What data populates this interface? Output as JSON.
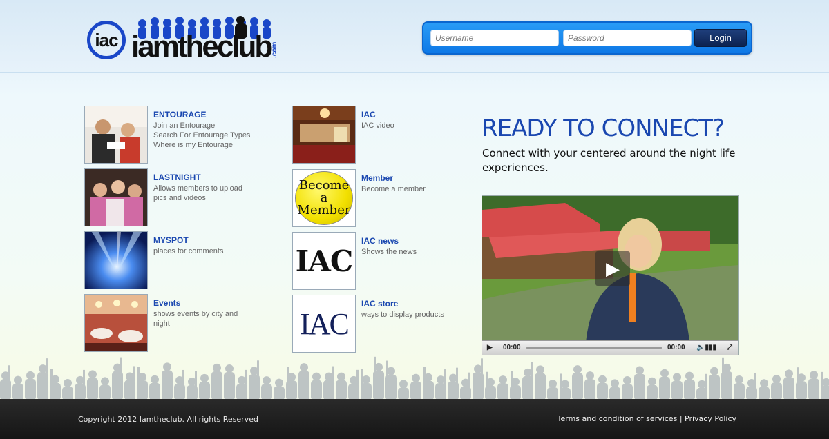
{
  "header": {
    "logo_short": "iac",
    "logo_word": "iamtheclub",
    "logo_com": ".com"
  },
  "login": {
    "username_placeholder": "Username",
    "password_placeholder": "Password",
    "button_label": "Login",
    "accent_color": "#1180e8"
  },
  "left_column": [
    {
      "title": "ENTOURAGE",
      "desc": [
        "Join an Entourage",
        "Search For Entourage Types",
        "Where is my Entourage"
      ],
      "thumb_icon": "people-dining-photo"
    },
    {
      "title": "LASTNIGHT",
      "desc": [
        "Allows members to upload",
        "pics and videos"
      ],
      "thumb_icon": "party-photo"
    },
    {
      "title": "MYSPOT",
      "desc": [
        "places for comments"
      ],
      "thumb_icon": "stage-lights-photo"
    },
    {
      "title": "Events",
      "desc": [
        "shows events by city and",
        "night"
      ],
      "thumb_icon": "banquet-photo"
    }
  ],
  "middle_column": [
    {
      "title": "IAC",
      "desc": [
        "IAC video"
      ],
      "thumb_icon": "bar-interior-photo"
    },
    {
      "title": "Member",
      "desc": [
        "Become a member"
      ],
      "thumb_icon": "become-member-badge",
      "thumb_text": [
        "Become",
        "a",
        "Member"
      ]
    },
    {
      "title": "IAC news",
      "desc": [
        "Shows the news"
      ],
      "thumb_icon": "iac-news-logo",
      "thumb_text": [
        "IAC"
      ]
    },
    {
      "title": "IAC store",
      "desc": [
        "ways to display products"
      ],
      "thumb_icon": "iac-store-logo",
      "thumb_text": [
        "IAC"
      ]
    }
  ],
  "ready": {
    "title": "READY TO CONNECT?",
    "text": "Connect with your centered around the night life experiences."
  },
  "video": {
    "current_time": "00:00",
    "duration": "00:00",
    "progress": 0
  },
  "footer": {
    "copyright": "Copyright 2012 Iamtheclub. All rights Reserved",
    "terms_link": "Terms and condition of services",
    "separator": "|",
    "privacy_link": "Privacy Policy"
  }
}
